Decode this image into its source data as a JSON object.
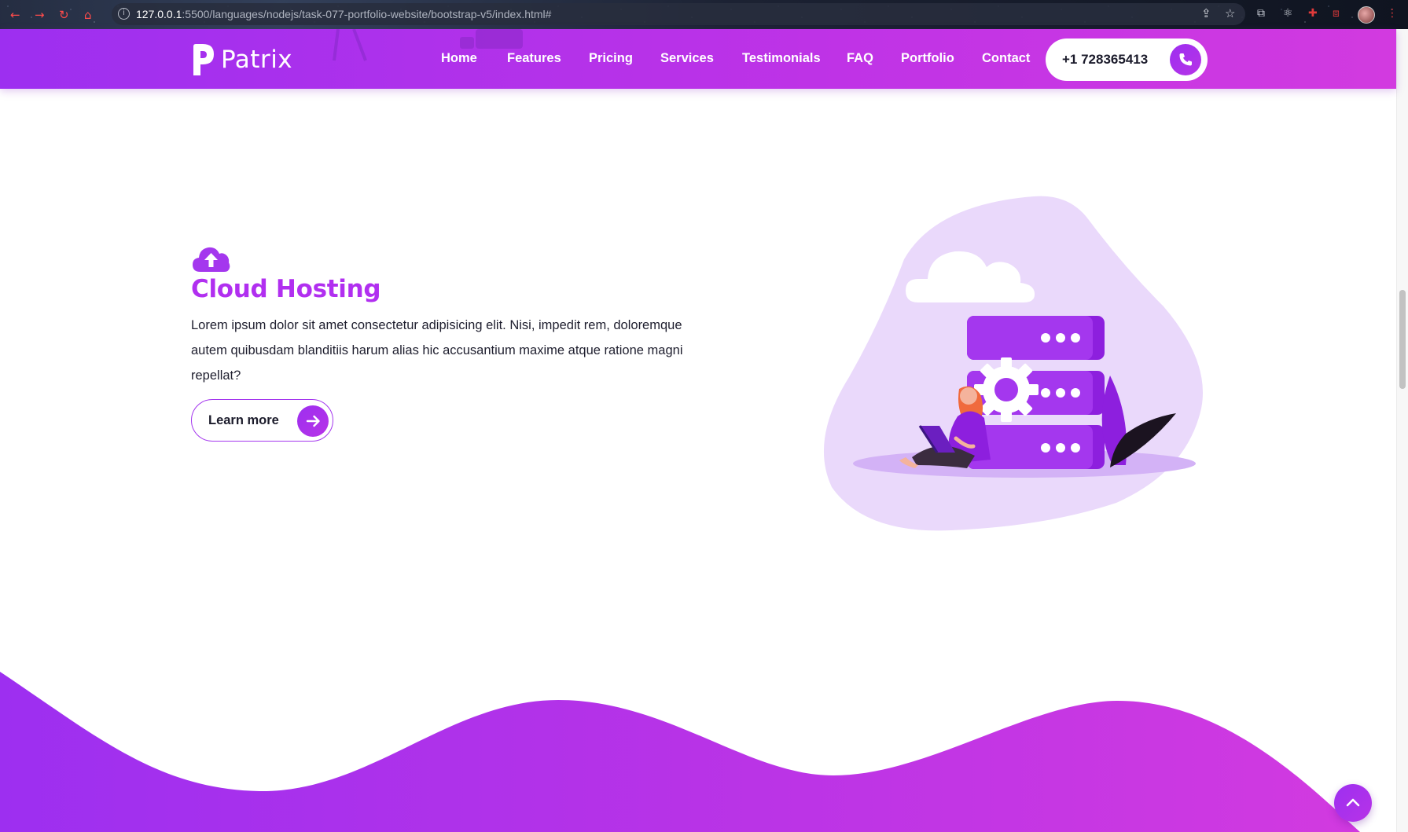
{
  "browser": {
    "url_host": "127.0.0.1",
    "url_rest": ":5500/languages/nodejs/task-077-portfolio-website/bootstrap-v5/index.html#"
  },
  "navbar": {
    "brand": "Patrix",
    "links": [
      "Home",
      "Features",
      "Pricing",
      "Services",
      "Testimonials",
      "FAQ",
      "Portfolio",
      "Contact"
    ],
    "phone": "+1 728365413"
  },
  "feature": {
    "icon": "cloud-upload-icon",
    "title": "Cloud Hosting",
    "description": "Lorem ipsum dolor sit amet consectetur adipisicing elit. Nisi, impedit rem, doloremque autem quibusdam blanditiis harum alias hic accusantium maxime atque ratione magni repellat?",
    "button": "Learn more"
  },
  "colors": {
    "brand_purple": "#9d2ff0",
    "brand_magenta": "#d23ae0",
    "title_purple": "#b12ff0",
    "blob_lavender": "#ead9fb"
  }
}
